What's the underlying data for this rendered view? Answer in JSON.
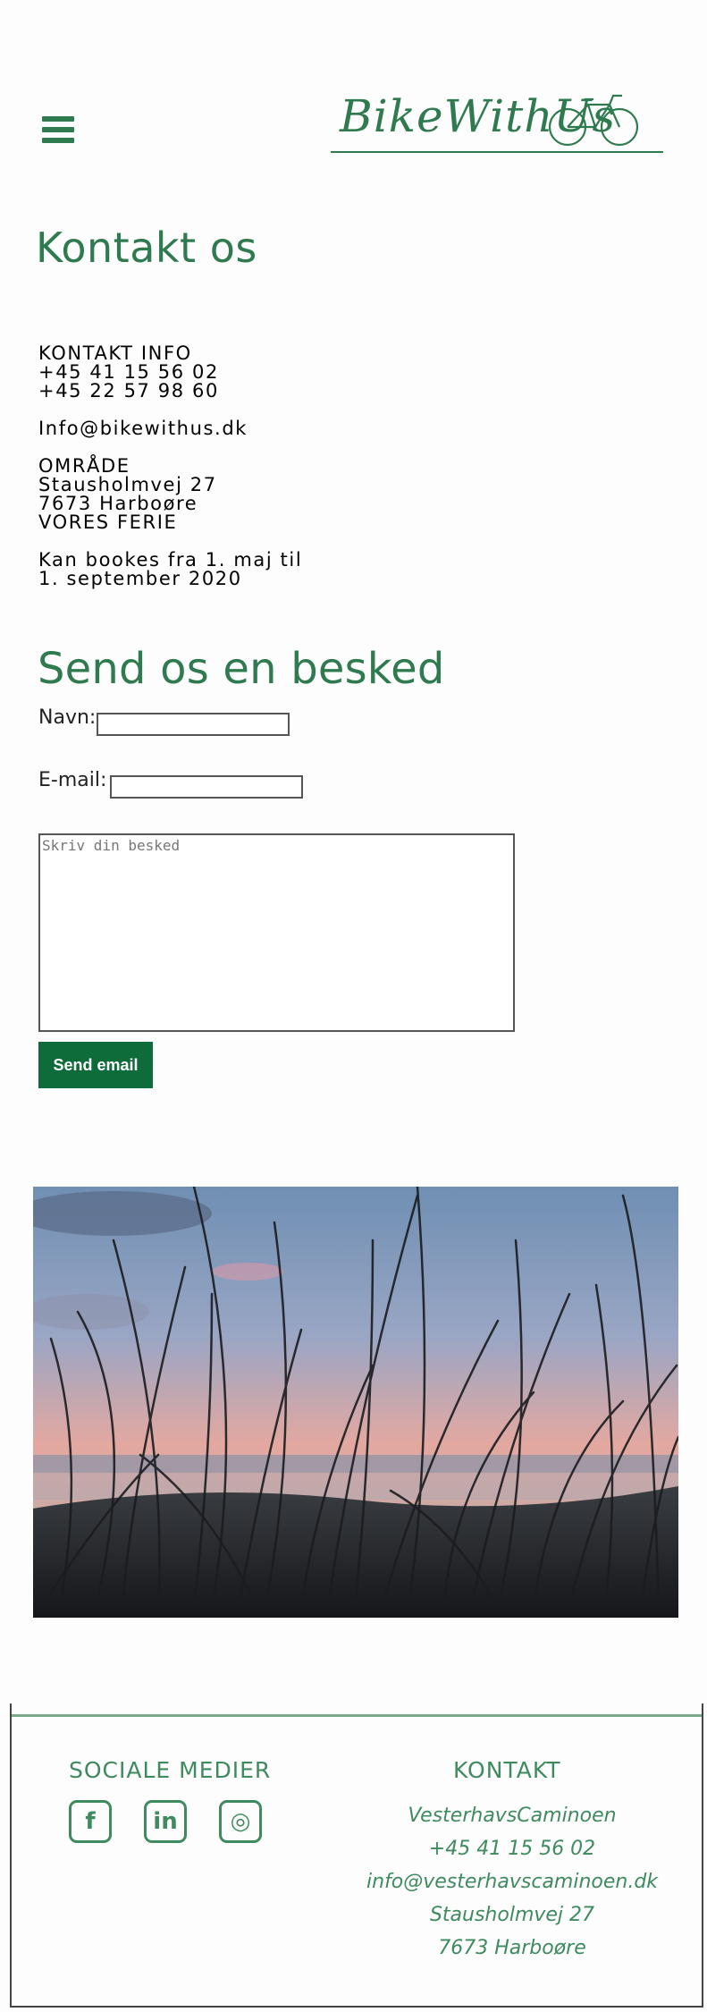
{
  "header": {
    "logo_text": "BikeWithUs",
    "menu_icon": "hamburger-menu-icon",
    "brand_color": "#2f7a4e"
  },
  "page_title": "Kontakt os",
  "contact_info": {
    "heading": "KONTAKT INFO",
    "phone1": "+45 41 15 56 02",
    "phone2": "+45 22 57 98 60",
    "email": "Info@bikewithus.dk",
    "area_heading": "OMRÅDE",
    "street": "Stausholmvej 27",
    "city": "7673 Harboøre",
    "area_extra": "VORES FERIE",
    "booking_line1": "Kan bookes fra 1. maj til",
    "booking_line2": "1. september 2020"
  },
  "form": {
    "title": "Send os en besked",
    "name_label": "Navn:",
    "name_value": "",
    "email_label": "E-mail:",
    "email_value": "",
    "message_placeholder": "Skriv din besked",
    "submit_label": "Send email",
    "button_color": "#0e6b3a"
  },
  "photo": {
    "subject": "beach-grass-sunset-image"
  },
  "footer": {
    "social_heading": "SOCIALE MEDIER",
    "social_icons": [
      "facebook-icon",
      "linkedin-icon",
      "instagram-icon"
    ],
    "social_glyphs": [
      "f",
      "in",
      "◎"
    ],
    "contact_heading": "KONTAKT",
    "contact_lines": [
      "VesterhavsCaminoen",
      "+45 41 15 56 02",
      "info@vesterhavscaminoen.dk",
      "Stausholmvej 27",
      "7673 Harboøre"
    ],
    "accent_color": "#3f8a5e"
  }
}
